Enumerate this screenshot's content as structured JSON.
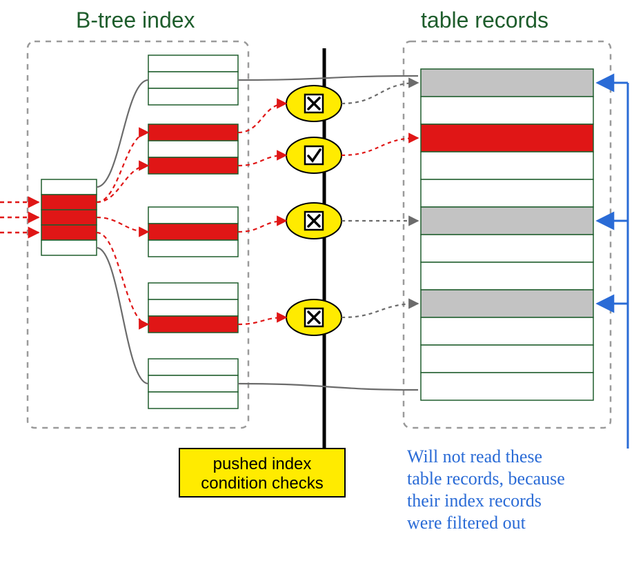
{
  "titles": {
    "btree": "B-tree index",
    "table": "table records"
  },
  "checkbox_label": "pushed index condition checks",
  "annotation_lines": [
    "Will not read these",
    "table records, because",
    "their index records",
    "were filtered out"
  ],
  "condition_checks": [
    {
      "result": "reject"
    },
    {
      "result": "accept"
    },
    {
      "result": "reject"
    },
    {
      "result": "reject"
    }
  ],
  "root_node": {
    "rows": 5,
    "selected": [
      1,
      2,
      3
    ]
  },
  "leaf_nodes": [
    {
      "rows": 3,
      "selected": []
    },
    {
      "rows": 3,
      "selected": [
        0,
        2
      ]
    },
    {
      "rows": 3,
      "selected": [
        1
      ]
    },
    {
      "rows": 3,
      "selected": [
        2
      ]
    },
    {
      "rows": 3,
      "selected": []
    }
  ],
  "table_block": {
    "rows": 12,
    "red_rows": [
      2
    ],
    "grey_rows": [
      0,
      5,
      8
    ]
  },
  "colors": {
    "red": "#e01616",
    "grey": "#c3c3c3",
    "yellow": "#ffeb00",
    "green_stroke": "#1e5d2c",
    "blue": "#2a6bd6",
    "dashed_border": "#9a9a9a"
  },
  "chart_data": {
    "type": "diagram",
    "title": "Index Condition Pushdown illustration",
    "description": "Root B-tree node has 5 slots with slots 1-3 selected (red). They fan out to 5 leaf index blocks. Selected leaf rows are evaluated by pushed index condition checks (4 evaluators). Only the 2nd check accepts; it points to a red table row. Rejected checks point to grey table rows that are not read.",
    "root_selected_slots": [
      1,
      2,
      3
    ],
    "leaves": [
      {
        "rows": 3,
        "selected_rows": []
      },
      {
        "rows": 3,
        "selected_rows": [
          0,
          2
        ]
      },
      {
        "rows": 3,
        "selected_rows": [
          1
        ]
      },
      {
        "rows": 3,
        "selected_rows": [
          2
        ]
      },
      {
        "rows": 3,
        "selected_rows": []
      }
    ],
    "condition_results": [
      "reject",
      "accept",
      "reject",
      "reject"
    ],
    "table_rows": 12,
    "table_read_rows": [
      2
    ],
    "table_skipped_rows": [
      0,
      5,
      8
    ]
  }
}
